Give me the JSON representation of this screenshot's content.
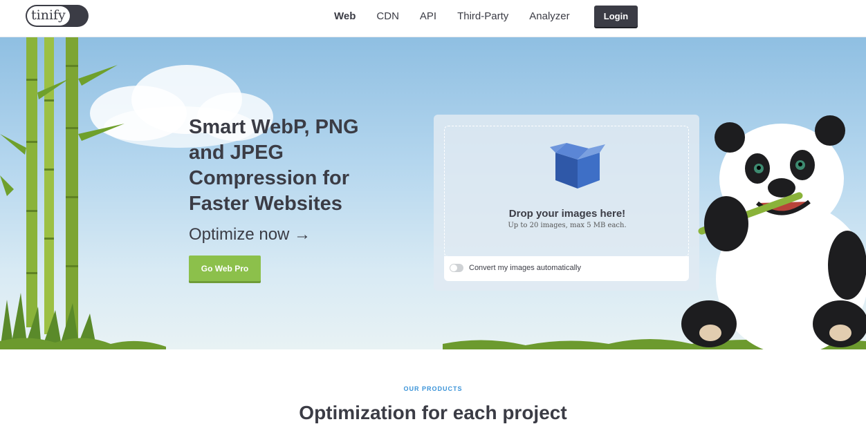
{
  "header": {
    "logo_text": "tinify",
    "nav": [
      {
        "label": "Web",
        "active": true
      },
      {
        "label": "CDN",
        "active": false
      },
      {
        "label": "API",
        "active": false
      },
      {
        "label": "Third-Party",
        "active": false
      },
      {
        "label": "Analyzer",
        "active": false
      }
    ],
    "login_label": "Login"
  },
  "hero": {
    "headline": "Smart WebP, PNG and JPEG Compression for Faster Websites",
    "subline": "Optimize now →",
    "cta_label": "Go Web Pro"
  },
  "dropzone": {
    "title": "Drop your images here!",
    "subtitle": "Up to 20 images, max 5 MB each.",
    "icon": "box-icon",
    "convert_label": "Convert my images automatically",
    "convert_enabled": false
  },
  "products": {
    "eyebrow": "OUR PRODUCTS",
    "title": "Optimization for each project"
  },
  "colors": {
    "dark": "#3b3c45",
    "green": "#8cc04b",
    "blue_accent": "#3a93d8"
  }
}
